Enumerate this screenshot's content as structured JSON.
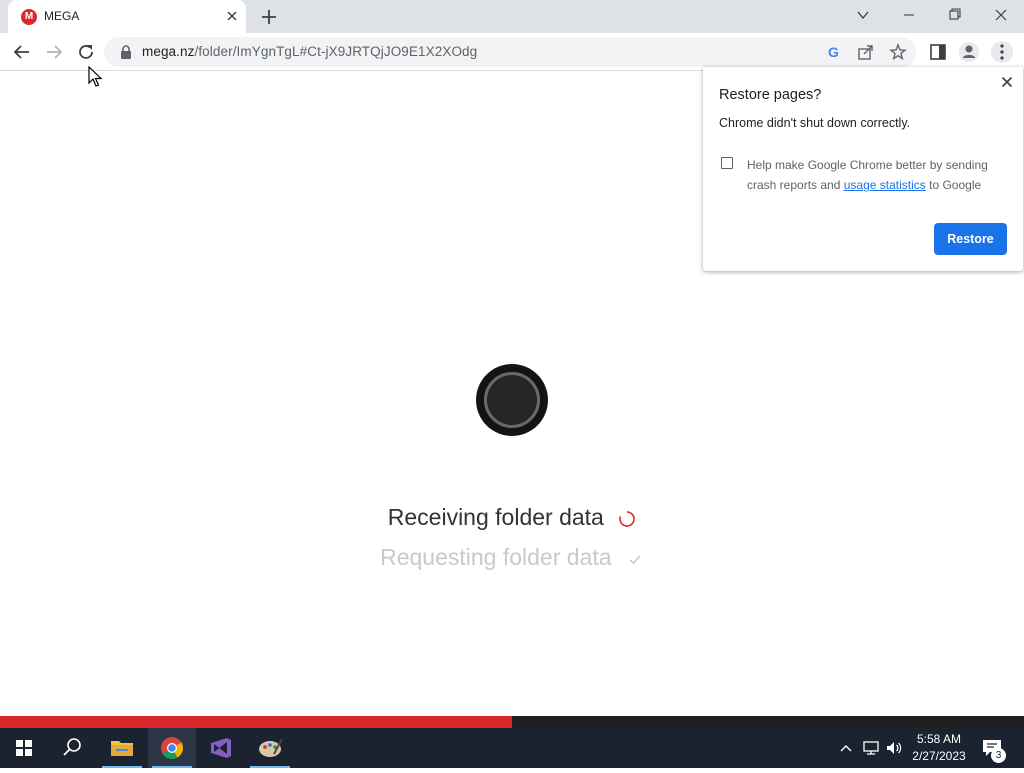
{
  "browser": {
    "tab": {
      "favicon_letter": "M",
      "title": "MEGA"
    },
    "url": {
      "host": "mega.nz",
      "path": "/folder/ImYgnTgL#Ct-jX9JRTQjJO9E1X2XOdg"
    }
  },
  "page": {
    "status_current": "Receiving folder data",
    "status_done": "Requesting folder data",
    "progress": 0.5
  },
  "restore_popup": {
    "title": "Restore pages?",
    "message": "Chrome didn't shut down correctly.",
    "checkbox_text_before": "Help make Google Chrome better by sending crash reports and",
    "link_text": "usage statistics",
    "checkbox_text_after": "to Google",
    "checked": false,
    "button_label": "Restore"
  },
  "taskbar": {
    "time": "5:58 AM",
    "date": "2/27/2023",
    "notification_count": "3"
  },
  "colors": {
    "brand_red": "#d9272e",
    "chrome_blue": "#1a73e8",
    "taskbar": "#1b2330"
  }
}
